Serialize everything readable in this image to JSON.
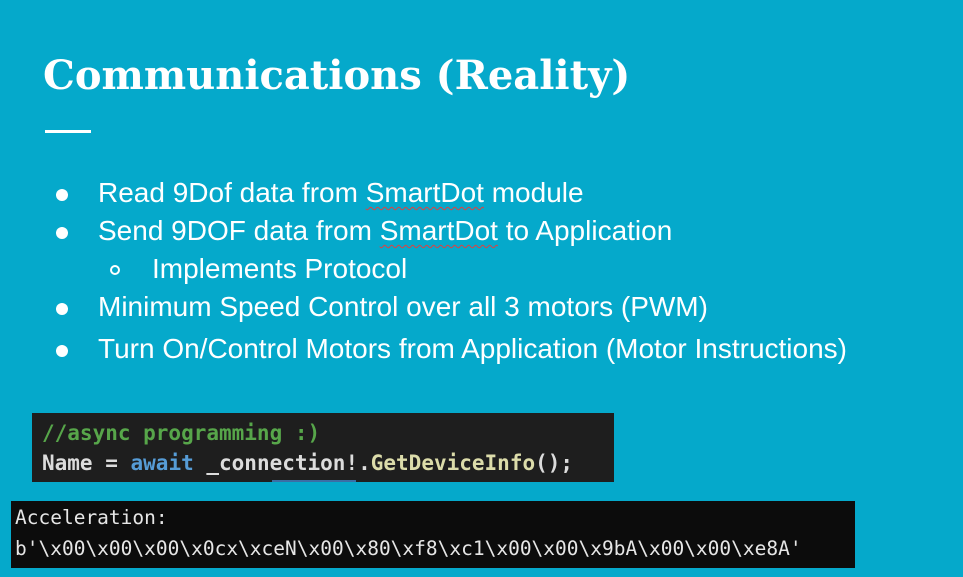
{
  "slide": {
    "title": "Communications (Reality)",
    "bullets": [
      {
        "level": 1,
        "pre": "Read 9Dof data from ",
        "squiggle": "SmartDot",
        "post": " module"
      },
      {
        "level": 1,
        "pre": "Send 9DOF data from ",
        "squiggle": "SmartDot",
        "post": " to Application"
      },
      {
        "level": 2,
        "text": "Implements Protocol"
      },
      {
        "level": 1,
        "text": "Minimum Speed Control over all 3 motors (PWM)"
      },
      {
        "level": 1,
        "text": "Turn On/Control Motors from Application (Motor Instructions)"
      }
    ]
  },
  "code_snippet": {
    "comment": "//async programming :)",
    "line2": {
      "name": "Name",
      "op": " = ",
      "keyword": "await",
      "rest": " _connection!.",
      "method": "GetDeviceInfo",
      "end": "();"
    }
  },
  "console_output": {
    "label": "Acceleration:",
    "value": "b'\\x00\\x00\\x00\\x0cx\\xceN\\x00\\x80\\xf8\\xc1\\x00\\x00\\x9bA\\x00\\x00\\xe8A'"
  },
  "colors": {
    "background": "#05a9cb",
    "code_bg": "#1e1e1e",
    "comment": "#57a64a",
    "keyword": "#569cd6",
    "method": "#dcdcaa",
    "console_bg": "#0c0c0c"
  }
}
